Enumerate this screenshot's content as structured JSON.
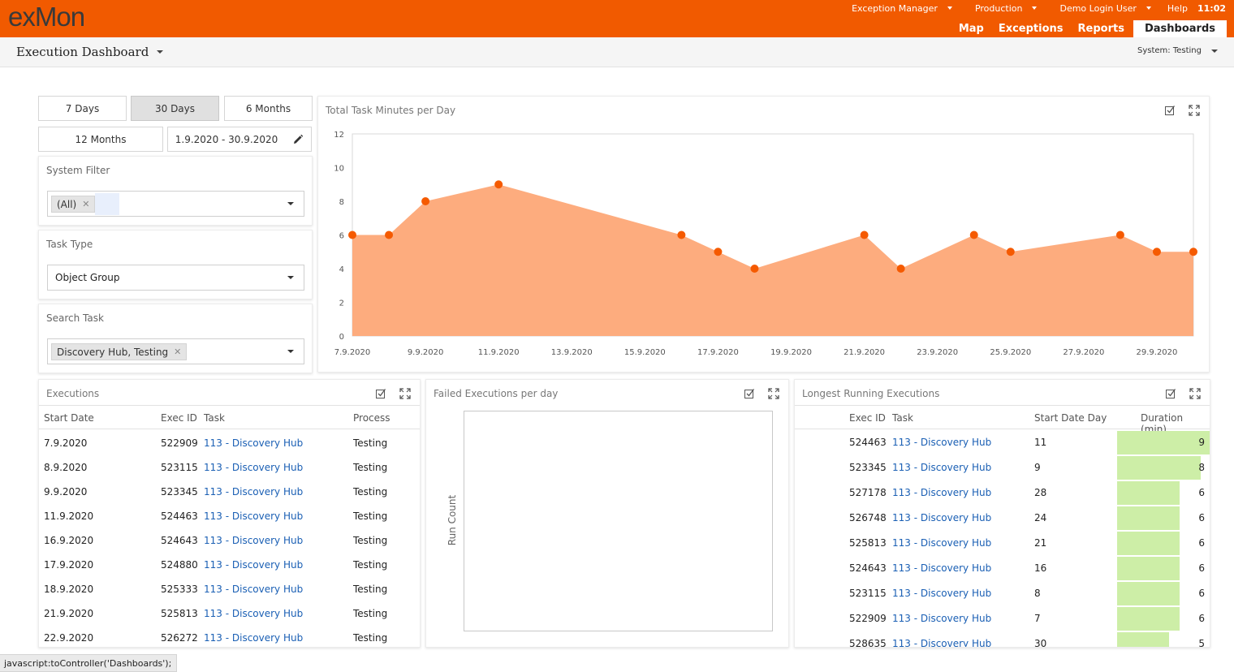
{
  "app": {
    "logo_left": "ex",
    "logo_mid": "Mon",
    "top_menus": [
      "Exception Manager",
      "Production",
      "Demo Login User"
    ],
    "help": "Help",
    "time": "11:02",
    "nav": [
      "Map",
      "Exceptions",
      "Reports",
      "Dashboards"
    ],
    "active_nav": "Dashboards"
  },
  "subheader": {
    "title": "Execution Dashboard",
    "system": "System: Testing"
  },
  "filters": {
    "ranges": [
      "7 Days",
      "30 Days",
      "6 Months",
      "12 Months"
    ],
    "selected_range": "30 Days",
    "date_range": "1.9.2020 - 30.9.2020",
    "system_filter": {
      "label": "System Filter",
      "tag": "(All)"
    },
    "task_type": {
      "label": "Task Type",
      "value": "Object Group"
    },
    "search_task": {
      "label": "Search Task",
      "tag": "Discovery Hub, Testing"
    }
  },
  "chart_data": [
    {
      "type": "area",
      "title": "Total Task Minutes per Day",
      "x": [
        "7.9.2020",
        "8.9.2020",
        "9.9.2020",
        "11.9.2020",
        "16.9.2020",
        "17.9.2020",
        "18.9.2020",
        "21.9.2020",
        "22.9.2020",
        "24.9.2020",
        "25.9.2020",
        "28.9.2020",
        "29.9.2020",
        "30.9.2020"
      ],
      "values": [
        6,
        6,
        8,
        9,
        6,
        5,
        4,
        6,
        4,
        6,
        5,
        6,
        5,
        5
      ],
      "x_ticks": [
        "7.9.2020",
        "9.9.2020",
        "11.9.2020",
        "13.9.2020",
        "15.9.2020",
        "17.9.2020",
        "19.9.2020",
        "21.9.2020",
        "23.9.2020",
        "25.9.2020",
        "27.9.2020",
        "29.9.2020"
      ],
      "y_ticks": [
        "0",
        "2",
        "4",
        "6",
        "8",
        "10",
        "12"
      ],
      "ylim": [
        0,
        12
      ],
      "xlim": [
        "7.9.2020",
        "30.9.2020"
      ],
      "fill_color": "#fdac7e",
      "marker_color": "#f55a00",
      "grid": false
    },
    {
      "type": "bar",
      "title": "Failed Executions per day",
      "ylabel": "Run Count",
      "values": []
    }
  ],
  "executions": {
    "title": "Executions",
    "columns": [
      "Start Date",
      "Exec ID",
      "Task",
      "Process"
    ],
    "rows": [
      [
        "7.9.2020",
        "522909",
        "113 - Discovery Hub",
        "Testing"
      ],
      [
        "8.9.2020",
        "523115",
        "113 - Discovery Hub",
        "Testing"
      ],
      [
        "9.9.2020",
        "523345",
        "113 - Discovery Hub",
        "Testing"
      ],
      [
        "11.9.2020",
        "524463",
        "113 - Discovery Hub",
        "Testing"
      ],
      [
        "16.9.2020",
        "524643",
        "113 - Discovery Hub",
        "Testing"
      ],
      [
        "17.9.2020",
        "524880",
        "113 - Discovery Hub",
        "Testing"
      ],
      [
        "18.9.2020",
        "525333",
        "113 - Discovery Hub",
        "Testing"
      ],
      [
        "21.9.2020",
        "525813",
        "113 - Discovery Hub",
        "Testing"
      ],
      [
        "22.9.2020",
        "526272",
        "113 - Discovery Hub",
        "Testing"
      ]
    ]
  },
  "longest": {
    "title": "Longest Running Executions",
    "columns": [
      "Exec ID",
      "Task",
      "Start Date Day",
      "Duration (min)"
    ],
    "bar_color": "#cdeea7",
    "rows": [
      [
        "524463",
        "113 - Discovery Hub",
        "11",
        "9"
      ],
      [
        "523345",
        "113 - Discovery Hub",
        "9",
        "8"
      ],
      [
        "527178",
        "113 - Discovery Hub",
        "28",
        "6"
      ],
      [
        "526748",
        "113 - Discovery Hub",
        "24",
        "6"
      ],
      [
        "525813",
        "113 - Discovery Hub",
        "21",
        "6"
      ],
      [
        "524643",
        "113 - Discovery Hub",
        "16",
        "6"
      ],
      [
        "523115",
        "113 - Discovery Hub",
        "8",
        "6"
      ],
      [
        "522909",
        "113 - Discovery Hub",
        "7",
        "6"
      ],
      [
        "528635",
        "113 - Discovery Hub",
        "30",
        "5"
      ]
    ]
  },
  "statusbar": "javascript:toController('Dashboards');"
}
